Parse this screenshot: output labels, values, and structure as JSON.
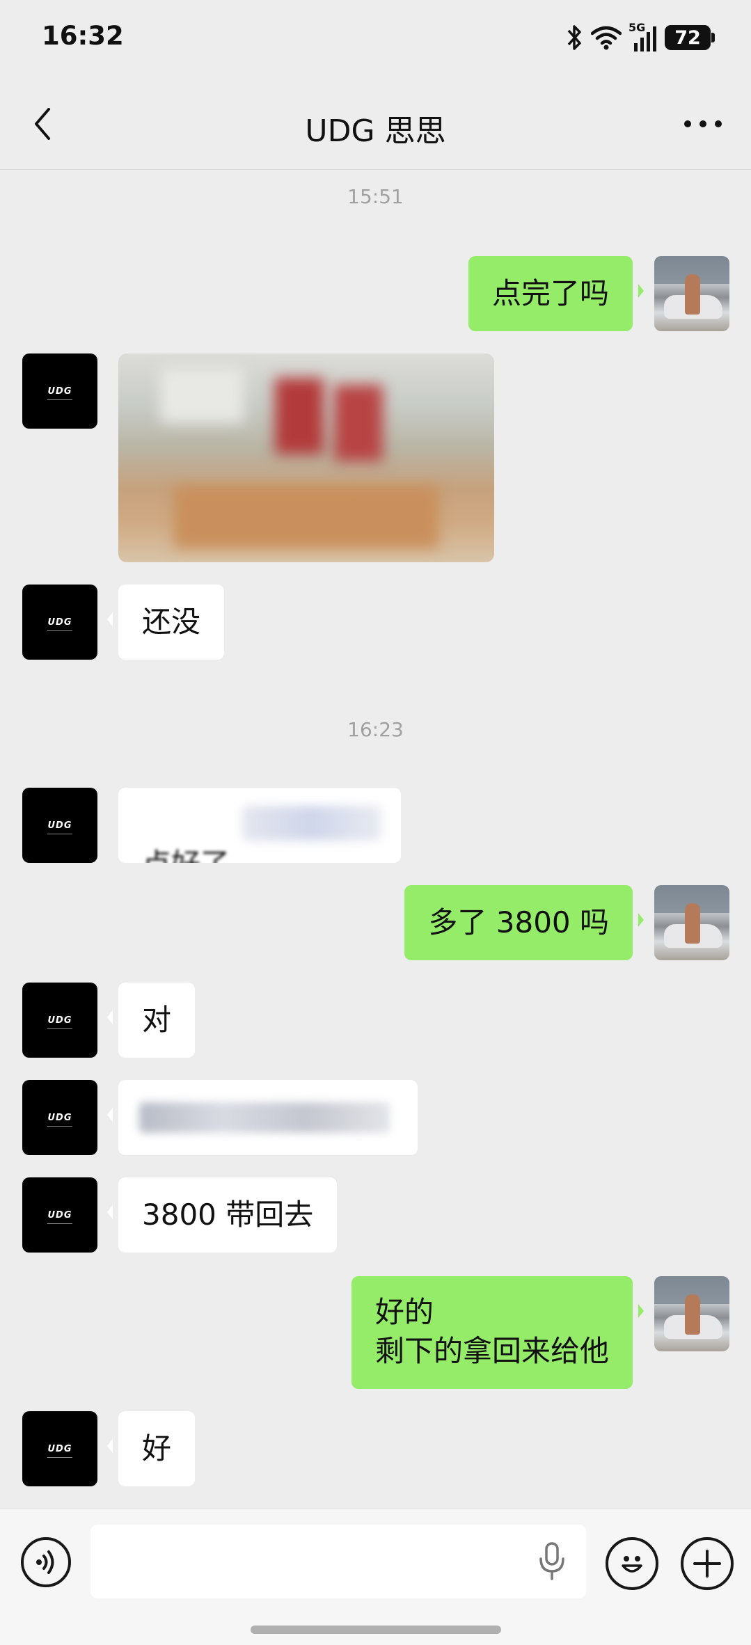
{
  "status_bar": {
    "time": "16:32",
    "network": "5G",
    "battery": "72",
    "icons": [
      "bluetooth-icon",
      "wifi-icon",
      "signal-icon",
      "battery-icon"
    ]
  },
  "header": {
    "title": "UDG 思思",
    "back_icon": "chevron-left-icon",
    "more_icon": "more-dots-icon"
  },
  "messages": {
    "ts1": "15:51",
    "m1": "点完了吗",
    "m3": "还没",
    "ts2": "16:23",
    "m4": "点好了",
    "m5": "多了 3800 吗",
    "m6": "对",
    "m8": "3800 带回去",
    "m9": "好的\n剩下的拿回来给他",
    "m10": "好"
  },
  "avatars": {
    "contact_logo": "UDG"
  },
  "input_bar": {
    "value": "",
    "icons": [
      "voice-icon",
      "microphone-icon",
      "emoji-icon",
      "plus-icon"
    ]
  },
  "colors": {
    "background": "#ededed",
    "outgoing_bubble": "#95ec69",
    "incoming_bubble": "#ffffff",
    "timestamp": "#a0a0a0"
  }
}
